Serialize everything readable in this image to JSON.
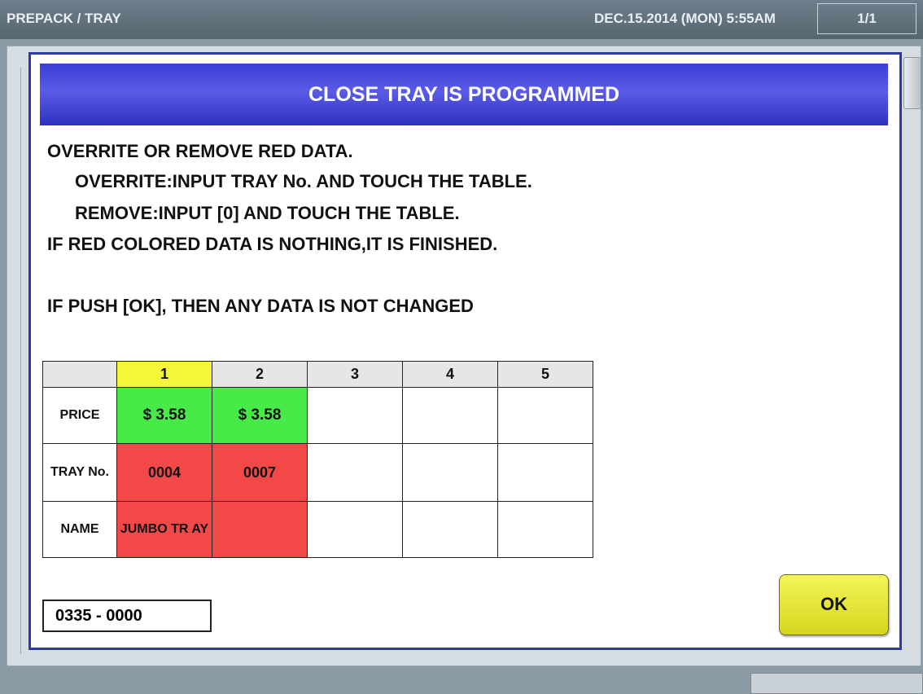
{
  "header": {
    "mode": "PREPACK / TRAY",
    "datetime": "DEC.15.2014 (MON)  5:55AM",
    "page_indicator": "1/1"
  },
  "dialog": {
    "title": "CLOSE TRAY IS PROGRAMMED",
    "messages": [
      "OVERRITE OR REMOVE RED DATA.",
      "OVERRITE:INPUT TRAY No. AND TOUCH THE TABLE.",
      "REMOVE:INPUT [0] AND TOUCH THE TABLE.",
      "IF RED COLORED DATA IS NOTHING,IT IS FINISHED.",
      "IF PUSH [OK], THEN ANY DATA IS NOT CHANGED"
    ],
    "table": {
      "columns": [
        "1",
        "2",
        "3",
        "4",
        "5"
      ],
      "row_labels": [
        "PRICE",
        "TRAY No.",
        "NAME"
      ],
      "price": [
        "$ 3.58",
        "$ 3.58",
        "",
        "",
        ""
      ],
      "tray_no": [
        "0004",
        "0007",
        "",
        "",
        ""
      ],
      "name": [
        "JUMBO TR AY",
        "",
        "",
        "",
        ""
      ]
    },
    "code": "0335 - 0000",
    "ok_label": "OK"
  },
  "colors": {
    "title_bar": "#3b3dd8",
    "selected_column": "#f5f53a",
    "price_highlight": "#48ea48",
    "red_data": "#f24848",
    "ok_button": "#e8e830"
  }
}
